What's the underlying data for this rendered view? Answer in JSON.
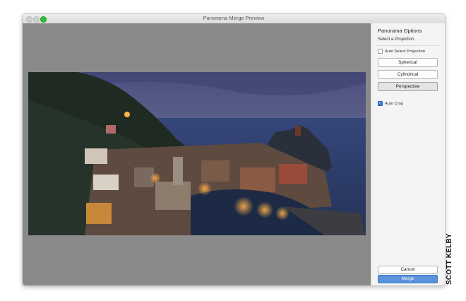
{
  "window": {
    "title": "Panorama Merge Preview"
  },
  "photo": {
    "subject": "panorama-preview"
  },
  "panel": {
    "heading": "Panorama Options",
    "subheading": "Select a Projection",
    "auto_select": {
      "label": "Auto Select Projection",
      "checked": false
    },
    "projections": [
      {
        "label": "Spherical",
        "selected": false
      },
      {
        "label": "Cylindrical",
        "selected": false
      },
      {
        "label": "Perspective",
        "selected": true
      }
    ],
    "auto_crop": {
      "label": "Auto Crop",
      "checked": true
    },
    "cancel_label": "Cancel",
    "merge_label": "Merge"
  },
  "credit": "SCOTT KELBY",
  "colors": {
    "accent": "#5a92dc",
    "preview_bg": "#8a8a8a",
    "panel_bg": "#f4f4f4"
  }
}
